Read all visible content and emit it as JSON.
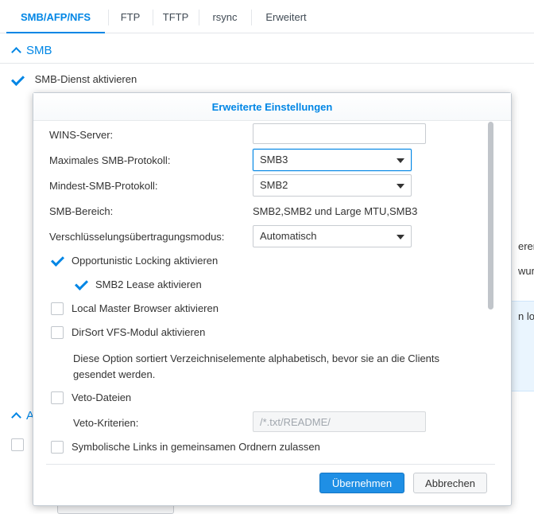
{
  "tabs": [
    {
      "label": "SMB/AFP/NFS",
      "active": true
    },
    {
      "label": "FTP"
    },
    {
      "label": "TFTP"
    },
    {
      "label": "rsync"
    },
    {
      "label": "Erweitert"
    }
  ],
  "background": {
    "smb_section_title": "SMB",
    "smb_enable_label": "SMB-Dienst aktivieren",
    "second_section_fragment": "A",
    "right_fragments": [
      "eren.",
      "wurd",
      "n loka"
    ]
  },
  "modal": {
    "title": "Erweiterte Einstellungen",
    "fields": {
      "wins_label": "WINS-Server:",
      "wins_value": "",
      "max_protocol_label": "Maximales SMB-Protokoll:",
      "max_protocol_value": "SMB3",
      "min_protocol_label": "Mindest-SMB-Protokoll:",
      "min_protocol_value": "SMB2",
      "range_label": "SMB-Bereich:",
      "range_value": "SMB2,SMB2 und Large MTU,SMB3",
      "encryption_label": "Verschlüsselungsübertragungsmodus:",
      "encryption_value": "Automatisch"
    },
    "checkboxes": {
      "oplock": {
        "label": "Opportunistic Locking aktivieren",
        "checked": true
      },
      "smb2_lease": {
        "label": "SMB2 Lease aktivieren",
        "checked": true
      },
      "local_master": {
        "label": "Local Master Browser aktivieren",
        "checked": false
      },
      "dirsort": {
        "label": "DirSort VFS-Modul aktivieren",
        "checked": false
      },
      "veto": {
        "label": "Veto-Dateien",
        "checked": false
      },
      "symlinks": {
        "label": "Symbolische Links in gemeinsamen Ordnern zulassen",
        "checked": false
      }
    },
    "dirsort_description": "Diese Option sortiert Verzeichniselemente alphabetisch, bevor sie an die Clients gesendet werden.",
    "veto_criteria_label": "Veto-Kriterien:",
    "veto_criteria_placeholder": "/*.txt/README/",
    "buttons": {
      "apply": "Übernehmen",
      "cancel": "Abbrechen"
    }
  },
  "colors": {
    "accent": "#0086e5",
    "primary_button": "#1f8fe5"
  }
}
